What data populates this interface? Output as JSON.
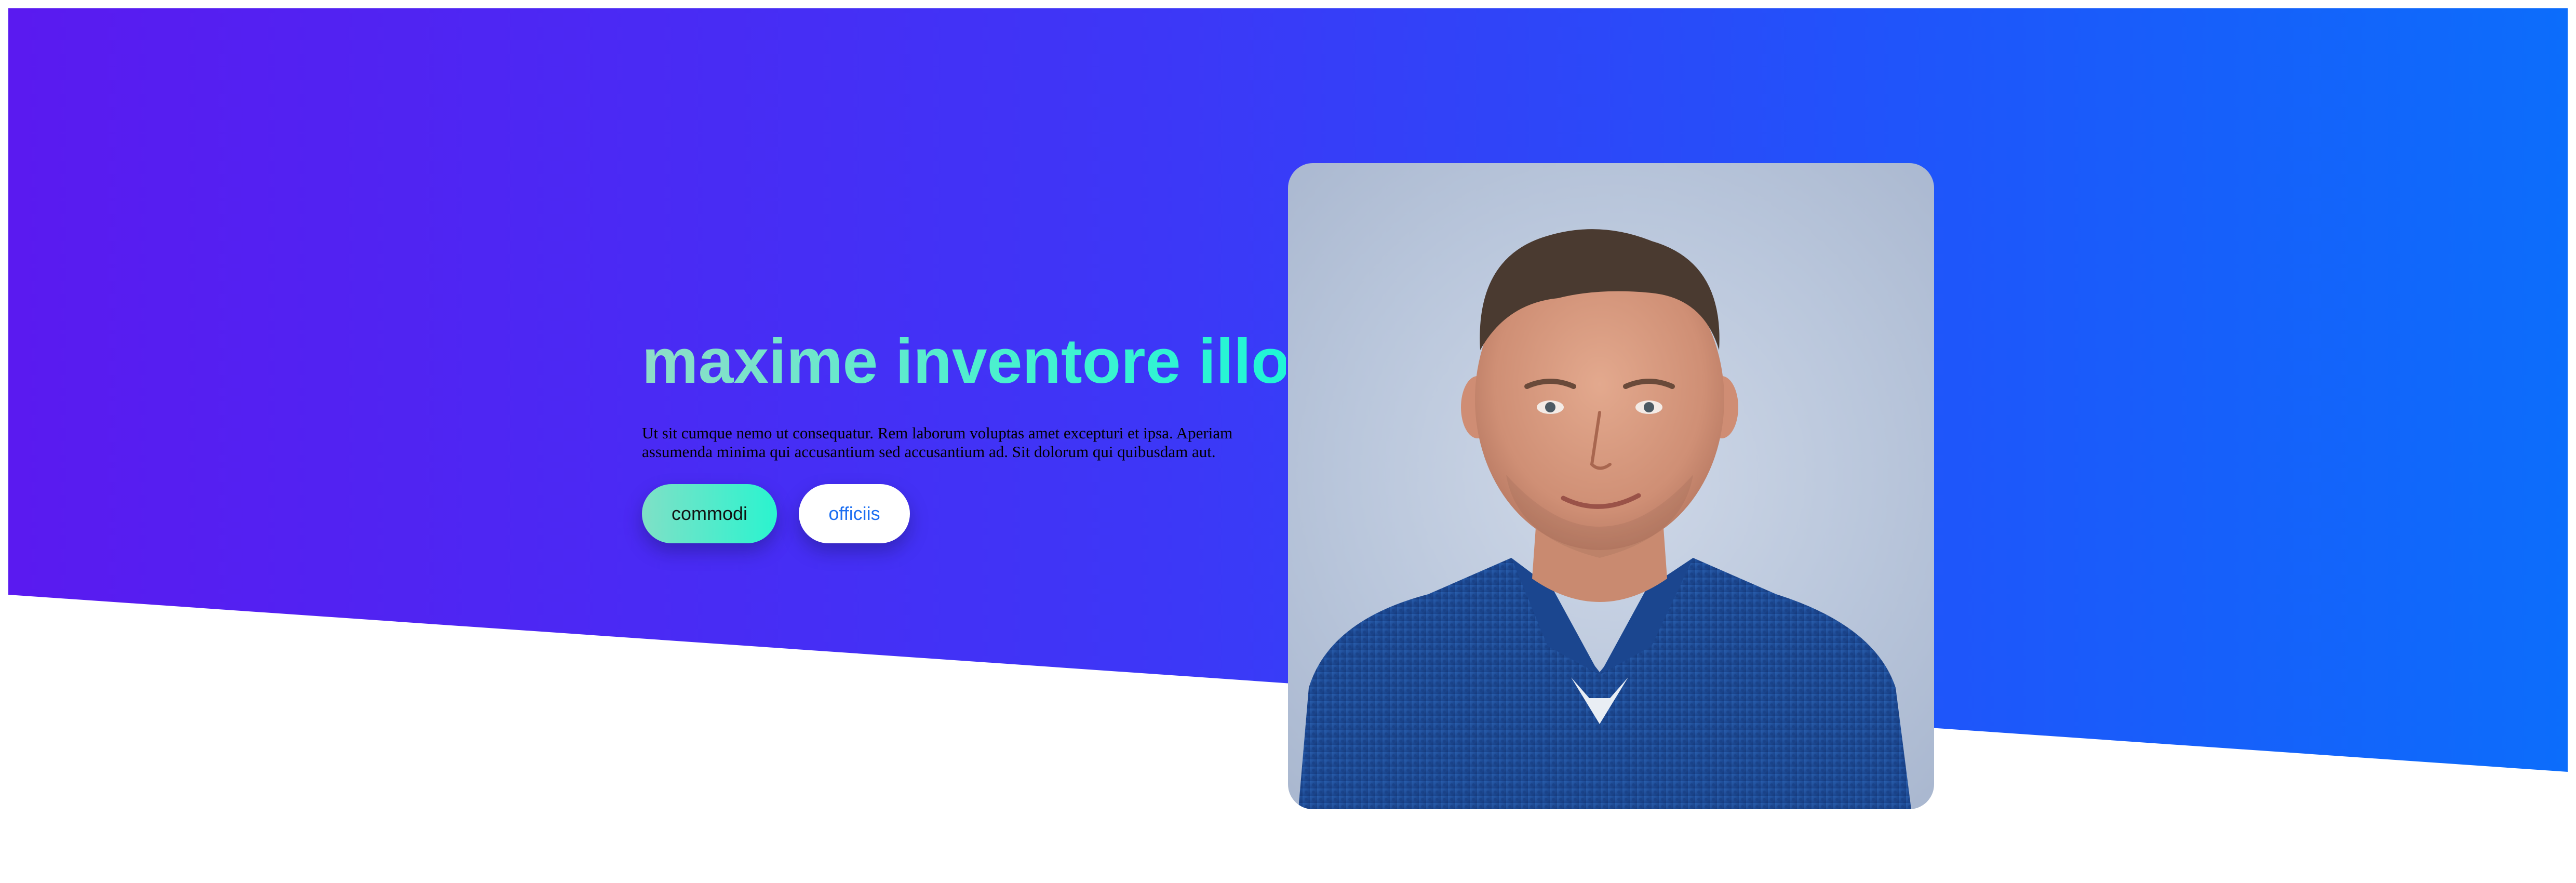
{
  "hero": {
    "headline": "maxime inventore illo",
    "description": "Ut sit cumque nemo ut consequatur. Rem laborum voluptas amet excepturi et ipsa. Aperiam assumenda minima qui accusantium sed accusantium ad. Sit dolorum qui quibusdam aut.",
    "primary_button": "commodi",
    "secondary_button": "officiis"
  },
  "colors": {
    "gradient_start": "#5a1af0",
    "gradient_end": "#0c6dfb",
    "headline_accent": "#1ff5d6",
    "secondary_button_text": "#1d6ff2"
  },
  "portrait": {
    "icon": "person-portrait-photo"
  }
}
